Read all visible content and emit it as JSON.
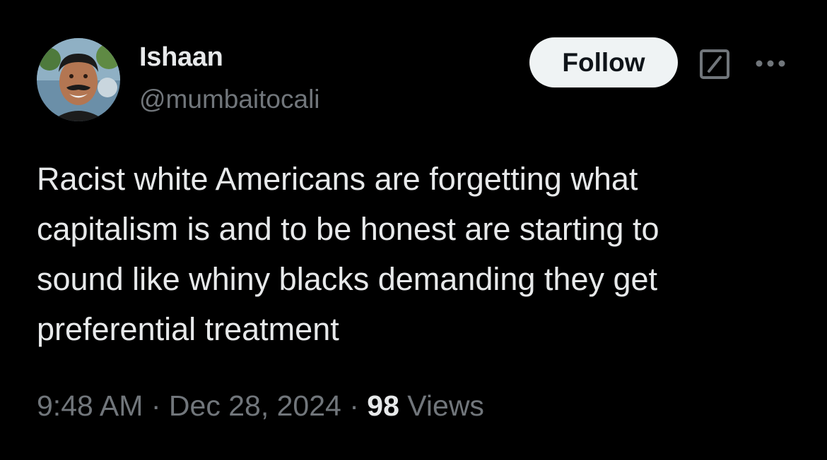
{
  "author": {
    "display_name": "Ishaan",
    "handle": "@mumbaitocali",
    "avatar_icon": "profile-photo"
  },
  "actions": {
    "follow_label": "Follow",
    "grok_icon": "grok-icon",
    "more_icon": "more-icon"
  },
  "tweet": {
    "text": "Racist white Americans are forgetting what\ncapitalism is and to be honest are starting to\nsound like whiny blacks demanding they get\npreferential treatment",
    "time": "9:48 AM",
    "separator": "·",
    "date": "Dec 28, 2024",
    "views_count": "98",
    "views_label": "Views"
  },
  "colors": {
    "background": "#000000",
    "primary_text": "#e7e9ea",
    "secondary_text": "#71767b",
    "follow_button_bg": "#eff3f4",
    "follow_button_text": "#0f1419"
  }
}
